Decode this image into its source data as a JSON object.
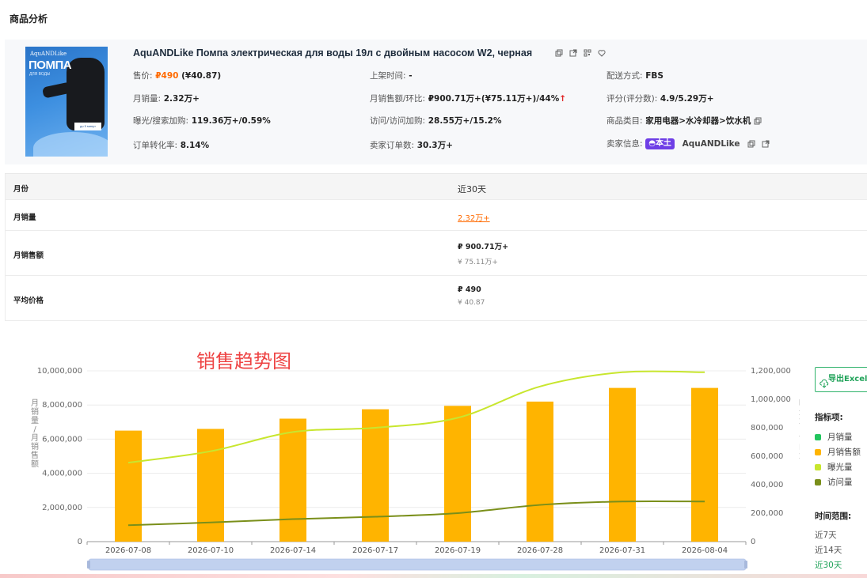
{
  "page": {
    "title": "商品分析"
  },
  "product": {
    "image_text": {
      "brand": "AquANDLike",
      "headline": "ПОМПА",
      "subline": "ДЛЯ ВОДЫ",
      "badge": "до 5 минут"
    },
    "name": "AquANDLike Помпа электрическая для воды 19л с двойным насосом W2, черная",
    "fields": {
      "price_label": "售价:",
      "price_rub": "₽490",
      "price_cny": "(¥40.87)",
      "listed_label": "上架时间:",
      "listed_value": "-",
      "delivery_label": "配送方式:",
      "delivery_value": "FBS",
      "monthly_sales_label": "月销量:",
      "monthly_sales_value": "2.32万+",
      "monthly_revenue_label": "月销售额/环比:",
      "monthly_revenue_value": "₽900.71万+(¥75.11万+)/44%",
      "monthly_revenue_trend": "↑",
      "rating_label": "评分(评分数):",
      "rating_value": "4.9/5.29万+",
      "exposure_label": "曝光/搜索加购:",
      "exposure_value": "119.36万+/0.59%",
      "visits_label": "访问/访问加购:",
      "visits_value": "28.55万+/15.2%",
      "category_label": "商品类目:",
      "category_value": "家用电器>水冷却器>饮水机",
      "conversion_label": "订单转化率:",
      "conversion_value": "8.14%",
      "seller_orders_label": "卖家订单数:",
      "seller_orders_value": "30.3万+",
      "seller_info_label": "卖家信息:",
      "seller_badge": "本土",
      "seller_name": "AquANDLike"
    }
  },
  "table": {
    "header": {
      "col1": "月份",
      "col2": "近30天"
    },
    "rows": {
      "sales": {
        "label": "月销量",
        "value": "2.32万+"
      },
      "revenue": {
        "label": "月销售额",
        "value": "₽ 900.71万+",
        "sub": "¥ 75.11万+"
      },
      "avg_price": {
        "label": "平均价格",
        "value": "₽ 490",
        "sub": "¥ 40.87"
      }
    }
  },
  "chart_title": "销售趋势图",
  "export_label": "导出Excel",
  "legend": {
    "title": "指标项:",
    "items": [
      {
        "label": "月销量",
        "color": "#22c55e"
      },
      {
        "label": "月销售额",
        "color": "#ffb400"
      },
      {
        "label": "曝光量",
        "color": "#c8e62e"
      },
      {
        "label": "访问量",
        "color": "#7a8f1a"
      }
    ]
  },
  "time_range": {
    "title": "时间范围:",
    "options": [
      "近7天",
      "近14天",
      "近30天"
    ],
    "active": "近30天"
  },
  "chart_data": {
    "type": "bar",
    "categories": [
      "2026-07-08",
      "2026-07-10",
      "2026-07-14",
      "2026-07-17",
      "2026-07-19",
      "2026-07-28",
      "2026-07-31",
      "2026-08-04"
    ],
    "ylabel": "月销量/月销售额",
    "y2label": "曝光量/访问量",
    "ylim": [
      0,
      10000000
    ],
    "y2lim": [
      0,
      1200000
    ],
    "yticks": [
      "10,000,000",
      "8,000,000",
      "6,000,000",
      "4,000,000",
      "2,000,000",
      "0"
    ],
    "y2ticks": [
      "1,200,000",
      "1,000,000",
      "800,000",
      "600,000",
      "400,000",
      "200,000",
      "0"
    ],
    "series": [
      {
        "name": "月销量",
        "axis": "left",
        "kind": "bar",
        "values": [
          5000,
          5200,
          6500,
          7200,
          7600,
          8800,
          12000,
          12500
        ]
      },
      {
        "name": "月销售额",
        "axis": "left",
        "kind": "bar",
        "values": [
          6500000,
          6600000,
          7200000,
          7750000,
          7950000,
          8200000,
          9000000,
          9000000
        ]
      },
      {
        "name": "曝光量",
        "axis": "right",
        "kind": "line",
        "values": [
          555000,
          635000,
          770000,
          800000,
          870000,
          1090000,
          1190000,
          1190000
        ]
      },
      {
        "name": "访问量",
        "axis": "right",
        "kind": "line",
        "values": [
          115000,
          135000,
          158000,
          175000,
          200000,
          258000,
          282000,
          282000
        ]
      }
    ]
  }
}
